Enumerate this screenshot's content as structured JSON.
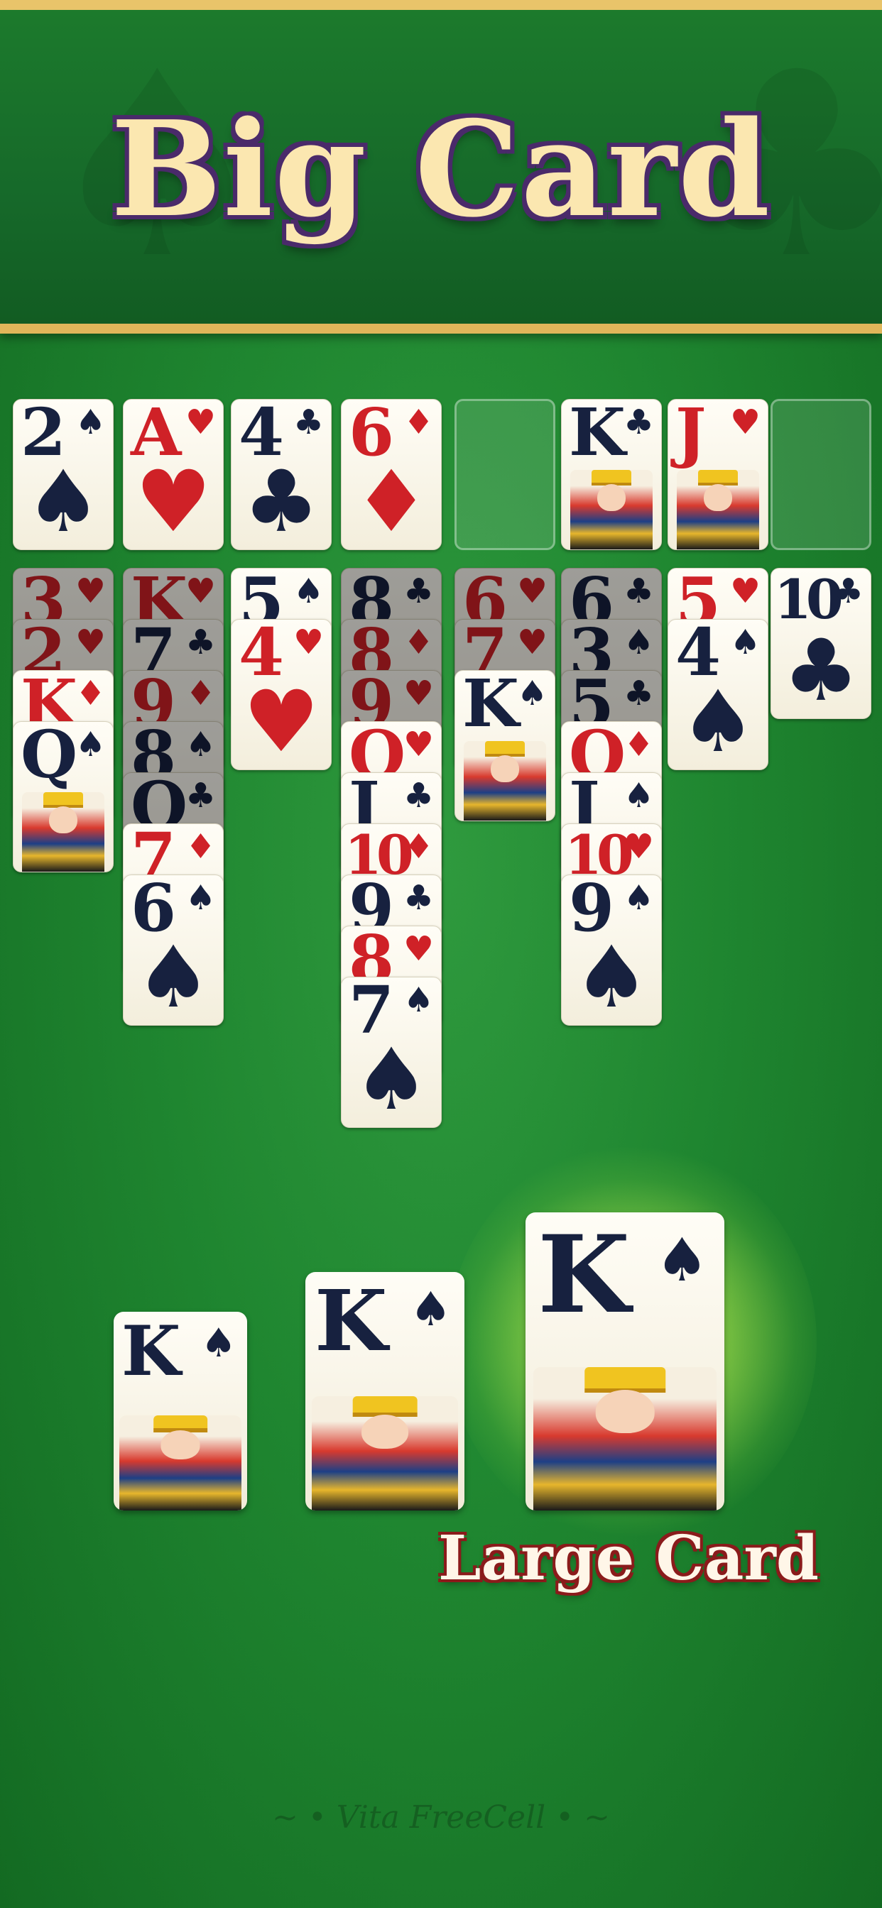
{
  "banner": {
    "title": "Big Card"
  },
  "board": {
    "top_row": [
      {
        "rank": "2",
        "suit": "♠",
        "color": "black"
      },
      {
        "rank": "A",
        "suit": "♥",
        "color": "red"
      },
      {
        "rank": "4",
        "suit": "♣",
        "color": "black"
      },
      {
        "rank": "6",
        "suit": "♦",
        "color": "red"
      },
      null,
      {
        "rank": "K",
        "suit": "♣",
        "color": "black",
        "face": true
      },
      {
        "rank": "J",
        "suit": "♥",
        "color": "red",
        "face": true
      },
      null
    ],
    "columns": [
      [
        {
          "rank": "3",
          "suit": "♥",
          "color": "red",
          "dim": true
        },
        {
          "rank": "2",
          "suit": "♥",
          "color": "red",
          "dim": true
        },
        {
          "rank": "K",
          "suit": "♦",
          "color": "red"
        },
        {
          "rank": "Q",
          "suit": "♠",
          "color": "black",
          "face": true
        }
      ],
      [
        {
          "rank": "K",
          "suit": "♥",
          "color": "red",
          "dim": true
        },
        {
          "rank": "7",
          "suit": "♣",
          "color": "black",
          "dim": true
        },
        {
          "rank": "9",
          "suit": "♦",
          "color": "red",
          "dim": true
        },
        {
          "rank": "8",
          "suit": "♠",
          "color": "black",
          "dim": true
        },
        {
          "rank": "Q",
          "suit": "♣",
          "color": "black",
          "dim": true
        },
        {
          "rank": "7",
          "suit": "♦",
          "color": "red"
        },
        {
          "rank": "6",
          "suit": "♠",
          "color": "black",
          "big": true
        }
      ],
      [
        {
          "rank": "5",
          "suit": "♠",
          "color": "black"
        },
        {
          "rank": "4",
          "suit": "♥",
          "color": "red",
          "big": true
        }
      ],
      [
        {
          "rank": "8",
          "suit": "♣",
          "color": "black",
          "dim": true
        },
        {
          "rank": "8",
          "suit": "♦",
          "color": "red",
          "dim": true
        },
        {
          "rank": "9",
          "suit": "♥",
          "color": "red",
          "dim": true
        },
        {
          "rank": "Q",
          "suit": "♥",
          "color": "red"
        },
        {
          "rank": "J",
          "suit": "♣",
          "color": "black"
        },
        {
          "rank": "10",
          "suit": "♦",
          "color": "red"
        },
        {
          "rank": "9",
          "suit": "♣",
          "color": "black"
        },
        {
          "rank": "8",
          "suit": "♥",
          "color": "red"
        },
        {
          "rank": "7",
          "suit": "♠",
          "color": "black",
          "big": true
        }
      ],
      [
        {
          "rank": "6",
          "suit": "♥",
          "color": "red",
          "dim": true
        },
        {
          "rank": "7",
          "suit": "♥",
          "color": "red",
          "dim": true
        },
        {
          "rank": "K",
          "suit": "♠",
          "color": "black",
          "face": true
        }
      ],
      [
        {
          "rank": "6",
          "suit": "♣",
          "color": "black",
          "dim": true
        },
        {
          "rank": "3",
          "suit": "♠",
          "color": "black",
          "dim": true
        },
        {
          "rank": "5",
          "suit": "♣",
          "color": "black",
          "dim": true
        },
        {
          "rank": "Q",
          "suit": "♦",
          "color": "red"
        },
        {
          "rank": "J",
          "suit": "♠",
          "color": "black"
        },
        {
          "rank": "10",
          "suit": "♥",
          "color": "red"
        },
        {
          "rank": "9",
          "suit": "♠",
          "color": "black",
          "big": true
        }
      ],
      [
        {
          "rank": "5",
          "suit": "♥",
          "color": "red"
        },
        {
          "rank": "4",
          "suit": "♠",
          "color": "black",
          "big": true
        }
      ],
      [
        {
          "rank": "10",
          "suit": "♣",
          "color": "black",
          "big": true
        }
      ]
    ]
  },
  "size_demo": [
    {
      "rank": "K",
      "suit": "♠"
    },
    {
      "rank": "K",
      "suit": "♠"
    },
    {
      "rank": "K",
      "suit": "♠"
    }
  ],
  "large_card_label": "Large Card",
  "watermark": "~ • Vita FreeCell • ~"
}
